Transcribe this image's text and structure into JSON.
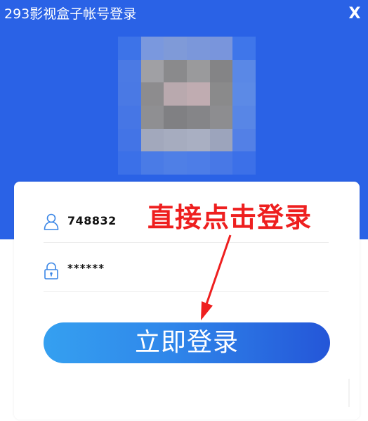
{
  "window": {
    "title": "293影视盒子帐号登录",
    "close_label": "X"
  },
  "login": {
    "username_value": "748832",
    "password_value": "******",
    "submit_label": "立即登录"
  },
  "annotation": {
    "text": "直接点击登录"
  },
  "icons": {
    "avatar": "blurred-avatar-image",
    "user": "user-icon",
    "lock": "lock-icon",
    "arrow": "red-arrow"
  },
  "colors": {
    "header_blue": "#2a62e6",
    "button_start": "#35a0f0",
    "button_end": "#2456d8",
    "annotation_red": "#ee1f1f",
    "icon_blue": "#3a86e6"
  }
}
